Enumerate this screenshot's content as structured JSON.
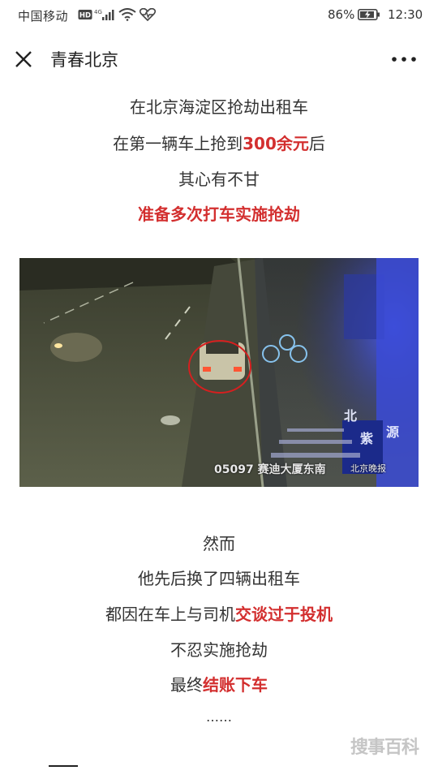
{
  "status_bar": {
    "carrier": "中国移动",
    "hd_badge": "HD",
    "network": "4G",
    "battery_percent": "86%",
    "time": "12:30"
  },
  "nav": {
    "title": "青春北京"
  },
  "article": {
    "line1": "在北京海淀区抢劫出租车",
    "line2_pre": "在第一辆车上抢到",
    "line2_red": "300余元",
    "line2_post": "后",
    "line3": "其心有不甘",
    "line4": "准备多次打车实施抢劫",
    "line5": "然而",
    "line6": "他先后换了四辆出租车",
    "line7_pre": "都因在车上与司机",
    "line7_red": "交谈过于投机",
    "line8": "不忍实施抢劫",
    "line9_pre": "最终",
    "line9_red": "结账下车",
    "line10": "……"
  },
  "video": {
    "camera_label": "05097 赛迪大厦东南",
    "source_watermark": "北京晚报"
  },
  "page_watermark": "搜事百科",
  "colors": {
    "highlight": "#d32f2f",
    "text": "#333333"
  }
}
